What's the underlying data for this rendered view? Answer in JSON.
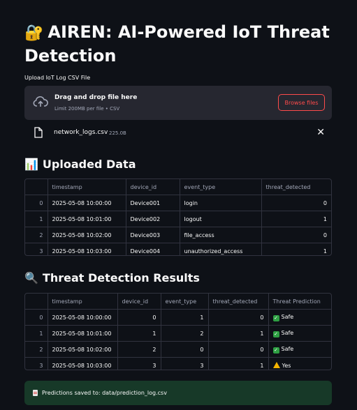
{
  "header": {
    "title": "AIREN: AI-Powered IoT Threat Detection",
    "title_icon": "lock-with-key-icon"
  },
  "upload": {
    "label": "Upload IoT Log CSV File",
    "drop_text": "Drag and drop file here",
    "limit_text": "Limit 200MB per file • CSV",
    "browse_label": "Browse files"
  },
  "file": {
    "name": "network_logs.csv",
    "size": "225.0B"
  },
  "uploaded_section": {
    "icon": "bar-chart-icon",
    "title": "Uploaded Data",
    "columns": [
      "",
      "timestamp",
      "device_id",
      "event_type",
      "threat_detected"
    ],
    "rows": [
      [
        "0",
        "2025-05-08 10:00:00",
        "Device001",
        "login",
        "0"
      ],
      [
        "1",
        "2025-05-08 10:01:00",
        "Device002",
        "logout",
        "1"
      ],
      [
        "2",
        "2025-05-08 10:02:00",
        "Device003",
        "file_access",
        "0"
      ],
      [
        "3",
        "2025-05-08 10:03:00",
        "Device004",
        "unauthorized_access",
        "1"
      ]
    ]
  },
  "results_section": {
    "icon": "magnifier-icon",
    "title": "Threat Detection Results",
    "columns": [
      "",
      "timestamp",
      "device_id",
      "event_type",
      "threat_detected",
      "Threat Prediction"
    ],
    "rows": [
      [
        "0",
        "2025-05-08 10:00:00",
        "0",
        "1",
        "0",
        "Safe"
      ],
      [
        "1",
        "2025-05-08 10:01:00",
        "1",
        "2",
        "1",
        "Safe"
      ],
      [
        "2",
        "2025-05-08 10:02:00",
        "2",
        "0",
        "0",
        "Safe"
      ],
      [
        "3",
        "2025-05-08 10:03:00",
        "3",
        "3",
        "1",
        "Yes"
      ]
    ],
    "prediction_icons": [
      "check-icon",
      "check-icon",
      "check-icon",
      "warning-icon"
    ]
  },
  "status": {
    "message": "Predictions saved to: data/prediction_log.csv"
  },
  "colors": {
    "background": "#0e1117",
    "accent": "#ff4b4b",
    "success_bg": "#173928"
  }
}
